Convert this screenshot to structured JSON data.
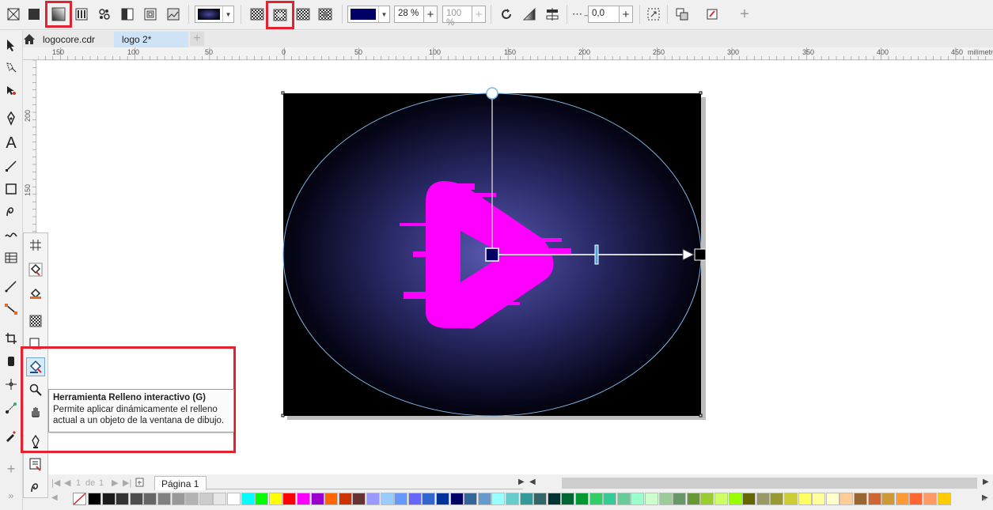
{
  "toolbar": {
    "outline_width_value": "28 %",
    "transparency_value": "100 %",
    "offset_value": "0,0",
    "accent_highlight": "#e0232e",
    "fill_color": "#000066"
  },
  "tabs": [
    {
      "label": "logocore.cdr"
    },
    {
      "label": "logo 2*"
    }
  ],
  "ruler": {
    "units": "milímetros",
    "h_ticks": [
      "150",
      "100",
      "50",
      "0",
      "50",
      "100",
      "150",
      "200",
      "250",
      "300",
      "350",
      "400",
      "450"
    ],
    "v_ticks": [
      "200",
      "150"
    ]
  },
  "tooltip": {
    "title": "Herramienta Relleno interactivo (G)",
    "line1": "Permite aplicar dinámicamente el relleno",
    "line2": "actual a un objeto de la ventana de dibujo."
  },
  "pagebar": {
    "page_of": "1",
    "de_label": "de",
    "total": "1",
    "page_tab": "Página 1"
  },
  "palette": [
    "#000000",
    "#1a1a1a",
    "#333333",
    "#4d4d4d",
    "#666666",
    "#808080",
    "#999999",
    "#b3b3b3",
    "#cccccc",
    "#e6e6e6",
    "#ffffff",
    "#00ffff",
    "#00ff00",
    "#ffff00",
    "#ff0000",
    "#ff00ff",
    "#9900cc",
    "#ff6600",
    "#cc3300",
    "#663333",
    "#9999ff",
    "#99ccff",
    "#6699ff",
    "#6666ff",
    "#3366cc",
    "#003399",
    "#000066",
    "#336699",
    "#6699cc",
    "#99ffff",
    "#66cccc",
    "#339999",
    "#336666",
    "#003333",
    "#006633",
    "#009933",
    "#33cc66",
    "#33cc99",
    "#66cc99",
    "#99ffcc",
    "#ccffcc",
    "#99cc99",
    "#669966",
    "#669933",
    "#99cc33",
    "#ccff66",
    "#99ff00",
    "#666600",
    "#999966",
    "#999933",
    "#cccc33",
    "#ffff66",
    "#ffff99",
    "#ffffcc",
    "#ffcc99",
    "#996633",
    "#cc6633",
    "#cc9933",
    "#ff9933",
    "#ff6633",
    "#ff9966",
    "#ffcc00"
  ]
}
